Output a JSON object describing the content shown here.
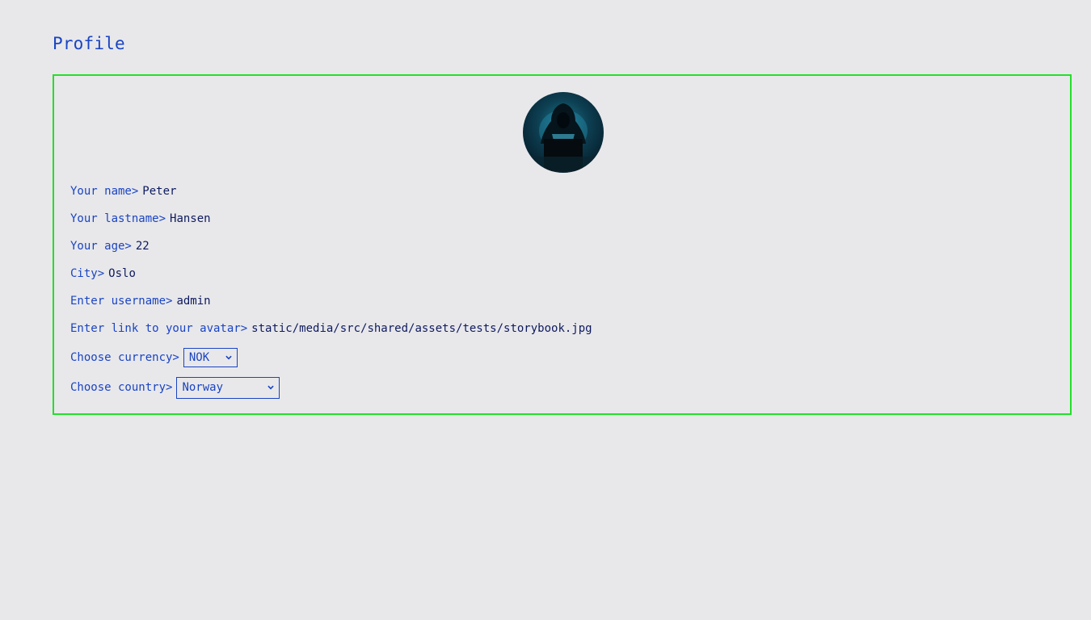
{
  "page": {
    "title": "Profile"
  },
  "profile": {
    "name_label": "Your name>",
    "name_value": "Peter",
    "lastname_label": "Your lastname>",
    "lastname_value": "Hansen",
    "age_label": "Your age>",
    "age_value": "22",
    "city_label": "City>",
    "city_value": "Oslo",
    "username_label": "Enter username>",
    "username_value": "admin",
    "avatar_label": "Enter link to your avatar>",
    "avatar_value": "static/media/src/shared/assets/tests/storybook.jpg",
    "currency_label": "Choose currency>",
    "currency_value": "NOK",
    "country_label": "Choose country>",
    "country_value": "Norway"
  },
  "colors": {
    "accent": "#1a44c2",
    "value_text": "#0e1a5e",
    "card_border": "#22e02a",
    "background": "#e8e8eb"
  },
  "icons": {
    "avatar": "hooded-hacker-avatar",
    "select": "chevron-down-icon"
  }
}
